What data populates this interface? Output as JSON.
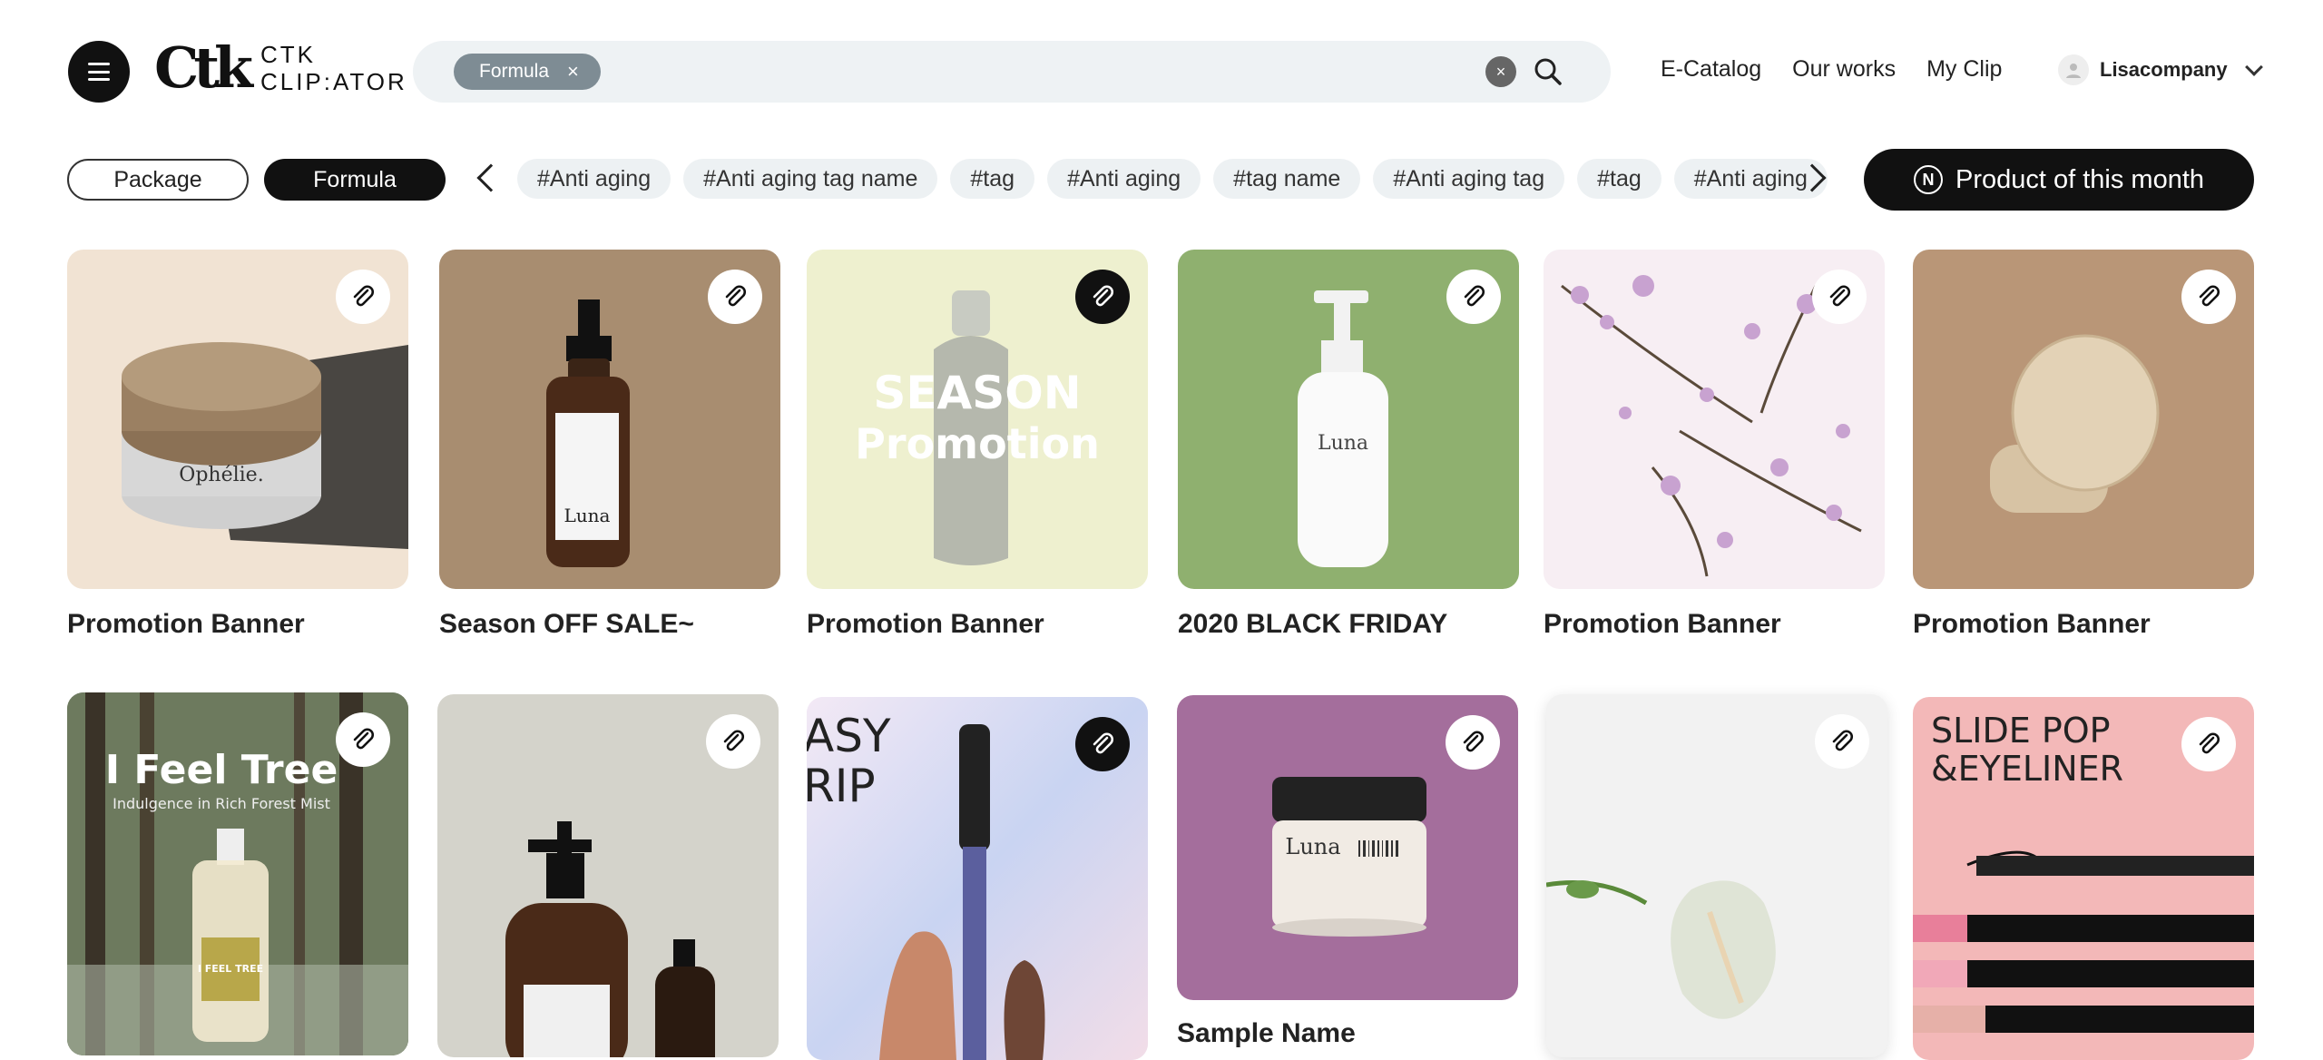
{
  "header": {
    "logo_mark": "Ctk",
    "logo_line1": "CTK",
    "logo_line2": "CLIP:ATOR",
    "search_chip": "Formula",
    "nav": [
      "E-Catalog",
      "Our works",
      "My Clip"
    ],
    "user_name": "Lisacompany"
  },
  "filters": {
    "segments": [
      "Package",
      "Formula"
    ],
    "tags": [
      "#Anti aging",
      "#Anti aging tag name",
      "#tag",
      "#Anti aging",
      "#tag name",
      "#Anti aging tag",
      "#tag",
      "#Anti aging"
    ],
    "product_button": "Product of this month",
    "product_badge": "N"
  },
  "cards_row1": [
    {
      "title": "Promotion Banner",
      "product_label": "Ophélie."
    },
    {
      "title": "Season OFF SALE~",
      "product_label": "Luna"
    },
    {
      "title": "Promotion Banner",
      "overlay_line1": "SEASON",
      "overlay_line2": "Promotion"
    },
    {
      "title": "2020 BLACK FRIDAY",
      "product_label": "Luna"
    },
    {
      "title": "Promotion Banner"
    },
    {
      "title": "Promotion Banner"
    }
  ],
  "cards_row2": [
    {
      "overlay_line1": "I Feel Tree",
      "overlay_line2": "Indulgence in Rich Forest Mist",
      "product_label": "I FEEL TREE"
    },
    {},
    {
      "overlay_line1": "ASY",
      "overlay_line2": "RIP"
    },
    {
      "product_label": "Luna",
      "partial_title": "Sample Name"
    },
    {},
    {
      "overlay_line1": "SLIDE POP",
      "overlay_line2": "&EYELINER"
    }
  ],
  "colors": {
    "primary": "#111111",
    "chip_bg": "#edf1f3",
    "search_bg": "#eef2f4",
    "search_chip": "#7e8c94"
  }
}
